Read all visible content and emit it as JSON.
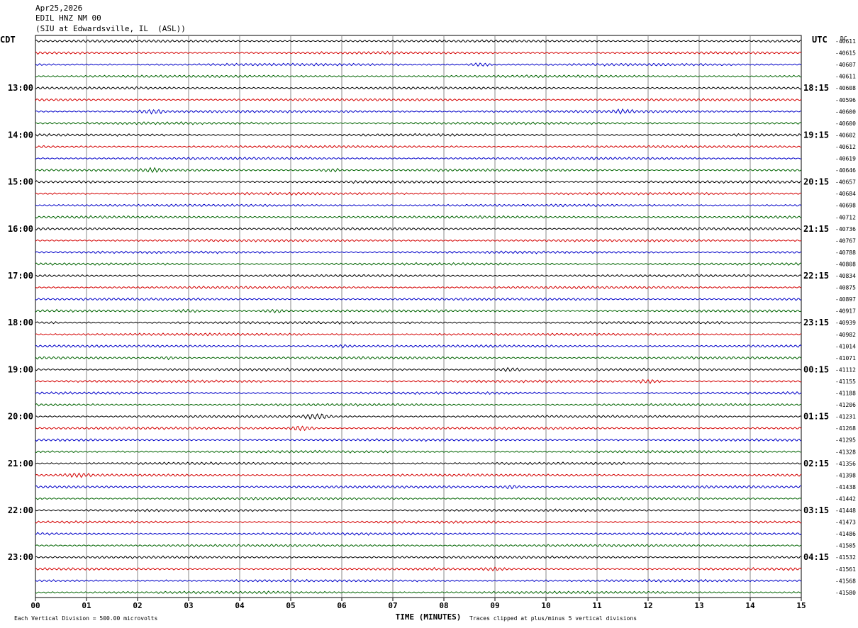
{
  "header": {
    "date": "Apr25,2026",
    "station": "EDIL HNZ NM 00",
    "location": "(SIU at Edwardsville, IL  (ASL))"
  },
  "left_zone": "CDT",
  "right_zone": "UTC",
  "dc_label": "DC",
  "footer": {
    "scale": "Each Vertical Division =  500.00 microvolts",
    "clip": "Traces clipped at plus/minus 5 vertical divisions",
    "xlabel": "TIME (MINUTES)"
  },
  "chart_data": {
    "type": "line",
    "title": "EDIL HNZ NM 00",
    "xlabel": "TIME (MINUTES)",
    "xlim": [
      0,
      15
    ],
    "x_ticks": [
      "00",
      "01",
      "02",
      "03",
      "04",
      "05",
      "06",
      "07",
      "08",
      "09",
      "10",
      "11",
      "12",
      "13",
      "14",
      "15"
    ],
    "rows_per_hour": 4,
    "row_colors": [
      "#000000",
      "#d40000",
      "#0000c8",
      "#006400"
    ],
    "left_hour_labels": [
      "13:00",
      "14:00",
      "15:00",
      "16:00",
      "17:00",
      "18:00",
      "19:00",
      "20:00",
      "21:00",
      "22:00",
      "23:00"
    ],
    "right_hour_labels": [
      "18:15",
      "19:15",
      "20:15",
      "21:15",
      "22:15",
      "23:15",
      "00:15",
      "01:15",
      "02:15",
      "03:15",
      "04:15"
    ],
    "dc_offsets": [
      "-40611",
      "-40615",
      "-40607",
      "-40611",
      "-40608",
      "-40596",
      "-40600",
      "-40600",
      "-40602",
      "-40612",
      "-40619",
      "-40646",
      "-40657",
      "-40684",
      "-40698",
      "-40712",
      "-40736",
      "-40767",
      "-40788",
      "-40808",
      "-40834",
      "-40875",
      "-40897",
      "-40917",
      "-40939",
      "-40982",
      "-41014",
      "-41071",
      "-41112",
      "-41155",
      "-41188",
      "-41206",
      "-41231",
      "-41268",
      "-41295",
      "-41328",
      "-41356",
      "-41398",
      "-41438",
      "-41442",
      "-41448",
      "-41473",
      "-41486",
      "-41505",
      "-41532",
      "-41561",
      "-41568",
      "-41580"
    ]
  }
}
